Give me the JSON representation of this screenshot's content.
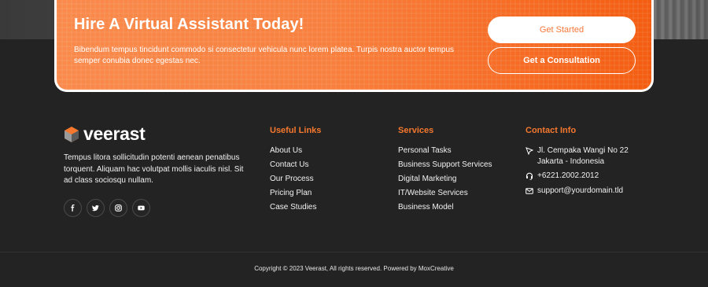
{
  "cta": {
    "title": "Hire A Virtual Assistant Today!",
    "text": "Bibendum tempus tincidunt commodo si consectetur vehicula nunc lorem platea. Turpis nostra auctor tempus semper conubia donec egestas nec.",
    "primary_button": "Get Started",
    "secondary_button": "Get a Consultation"
  },
  "brand": {
    "name": "veerast",
    "description": "Tempus litora sollicitudin potenti aenean penatibus torquent. Aliquam hac volutpat mollis iaculis nisl. Sit ad class sociosqu nullam.",
    "socials": [
      "facebook-icon",
      "twitter-icon",
      "instagram-icon",
      "youtube-icon"
    ]
  },
  "useful_links": {
    "title": "Useful Links",
    "items": [
      "About Us",
      "Contact Us",
      "Our Process",
      "Pricing Plan",
      "Case Studies"
    ]
  },
  "services": {
    "title": "Services",
    "items": [
      "Personal Tasks",
      "Business Support Services",
      "Digital Marketing",
      "IT/Website Services",
      "Business Model"
    ]
  },
  "contact": {
    "title": "Contact Info",
    "address_line1": "Jl. Cempaka Wangi No 22",
    "address_line2": "Jakarta - Indonesia",
    "phone": "+6221.2002.2012",
    "email": "support@yourdomain.tld"
  },
  "footer": {
    "copyright": "Copyright © 2023 Veerast, All rights reserved. Powered by MoxCreative"
  },
  "colors": {
    "accent": "#f5782e",
    "background": "#232323",
    "text": "#ffffff"
  }
}
